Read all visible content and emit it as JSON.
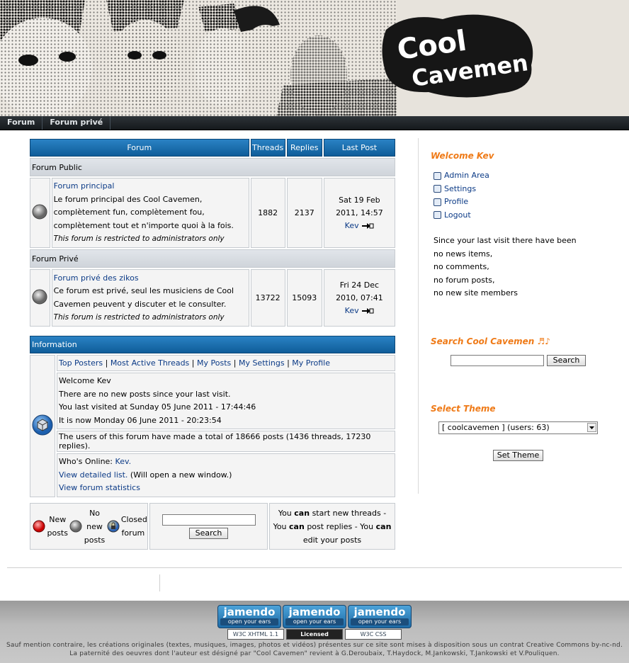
{
  "banner": {
    "logo_line1": "Cool",
    "logo_line2": "Cavemen"
  },
  "nav": [
    "Forum",
    "Forum privé"
  ],
  "forum_table": {
    "headers": {
      "forum": "Forum",
      "threads": "Threads",
      "replies": "Replies",
      "last_post": "Last Post"
    },
    "categories": [
      {
        "name": "Forum Public",
        "forums": [
          {
            "title": "Forum principal",
            "description": "Le forum principal des Cool Cavemen, complètement fun, complètement fou, complètement tout et n'importe quoi à la fois.",
            "restriction": "This forum is restricted to administrators only",
            "threads": "1882",
            "replies": "2137",
            "last_date": "Sat 19 Feb 2011, 14:57",
            "last_user": "Kev"
          }
        ]
      },
      {
        "name": "Forum Privé",
        "forums": [
          {
            "title": "Forum privé des zikos",
            "description": "Ce forum est privé, seul les musiciens de Cool Cavemen peuvent y discuter et le consulter.",
            "restriction": "This forum is restricted to administrators only",
            "threads": "13722",
            "replies": "15093",
            "last_date": "Fri 24 Dec 2010, 07:41",
            "last_user": "Kev"
          }
        ]
      }
    ]
  },
  "info": {
    "header": "Information",
    "links": [
      "Top Posters",
      "Most Active Threads",
      "My Posts",
      "My Settings",
      "My Profile"
    ],
    "welcome": "Welcome Kev",
    "no_new": "There are no new posts since your last visit.",
    "last_visit": "You last visited at Sunday 05 June 2011 - 17:44:46",
    "now": "It is now Monday 06 June 2011 - 20:23:54",
    "totals": "The users of this forum have made a total of 18666 posts (1436 threads, 17230 replies).",
    "online_label": "Who's Online:",
    "online_user": "Kev.",
    "detailed_link": "View detailed list.",
    "detailed_note": "(Will open a new window.)",
    "stats_link": "View forum statistics"
  },
  "legend": {
    "new_posts": "New posts",
    "no_new_posts": "No new posts",
    "closed_forum": "Closed forum",
    "search_button": "Search",
    "search_value": "",
    "perm_1": "You",
    "perm_can": "can",
    "perm_2": "start new threads - You",
    "perm_3": "post replies - You",
    "perm_4": "edit your posts"
  },
  "sidebar": {
    "welcome_title": "Welcome Kev",
    "menu": [
      "Admin Area",
      "Settings",
      "Profile",
      "Logout"
    ],
    "since_lines": [
      "Since your last visit there have been",
      "no news items,",
      "no comments,",
      "no forum posts,",
      "no new site members"
    ],
    "search_title": "Search Cool Cavemen ♬♪",
    "search_value": "",
    "search_button": "Search",
    "theme_title": "Select Theme",
    "theme_selected": "[ coolcavemen ] (users: 63)",
    "theme_button": "Set Theme"
  },
  "footer": {
    "jamendo": [
      {
        "name": "jamendo",
        "tag": "open your ears"
      },
      {
        "name": "jamendo",
        "tag": "open your ears"
      },
      {
        "name": "jamendo",
        "tag": "open your ears"
      }
    ],
    "badges": {
      "xhtml": "W3C XHTML 1.1",
      "cc": "Licensed",
      "css": "W3C CSS"
    },
    "legal": "Sauf mention contraire, les créations originales (textes, musiques, images, photos et vidéos) présentes sur ce site sont mises à disposition sous un contrat Creative Commons by-nc-nd. La paternité des oeuvres dont l'auteur est désigné par \"Cool Cavemen\" revient à G.Deroubaix, T.Haydock, M.Jankowski, T.Jankowski et V.Pouliquen."
  }
}
